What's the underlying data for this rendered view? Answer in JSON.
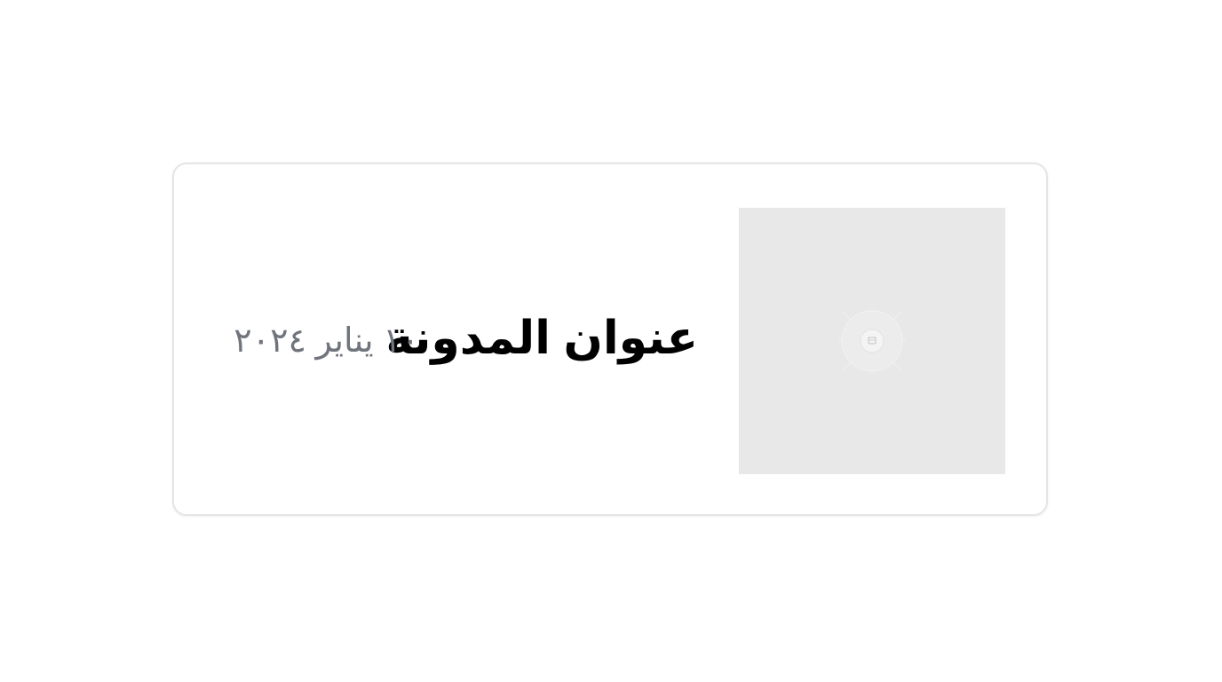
{
  "post": {
    "title": "عنوان المدونة",
    "date": "١٠ يناير ٢٠٢٤",
    "image_icon": "image-placeholder-icon"
  },
  "colors": {
    "card_border": "#e5e5e8",
    "image_background": "#e8e8e8",
    "title": "#000000",
    "date": "#70747c"
  }
}
